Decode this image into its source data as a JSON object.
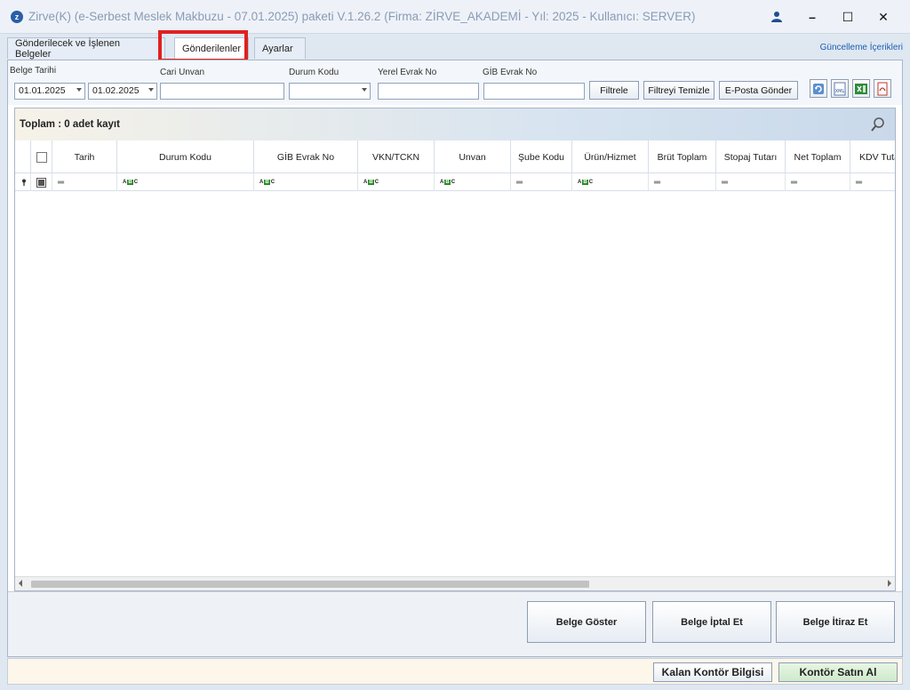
{
  "window": {
    "title": "Zirve(K)  (e-Serbest Meslek Makbuzu - 07.01.2025) paketi V.1.26.2 (Firma: ZİRVE_AKADEMİ - Yıl: 2025 - Kullanıcı: SERVER)",
    "minimize": "–",
    "maximize": "☐",
    "close": "✕"
  },
  "tabs": [
    {
      "label": "Gönderilecek ve İşlenen Belgeler"
    },
    {
      "label": "Gönderilenler"
    },
    {
      "label": "Ayarlar"
    }
  ],
  "update_link": "Güncelleme İçerikleri",
  "filters": {
    "belge_tarihi_label": "Belge Tarihi",
    "date_from": "01.01.2025",
    "date_to": "01.02.2025",
    "cari_unvan_label": "Cari Unvan",
    "cari_unvan_value": "",
    "durum_kodu_label": "Durum Kodu",
    "durum_kodu_value": "",
    "yerel_evrak_label": "Yerel Evrak No",
    "yerel_evrak_value": "",
    "gib_evrak_label": "GİB Evrak No",
    "gib_evrak_value": "",
    "filtrele": "Filtrele",
    "filtreyi_temizle": "Filtreyi Temizle",
    "eposta_gonder": "E-Posta Gönder",
    "xml_label": "XML"
  },
  "grid": {
    "total": "Toplam : 0 adet kayıt",
    "columns": [
      "Tarih",
      "Durum Kodu",
      "GİB Evrak No",
      "VKN/TCKN",
      "Unvan",
      "Şube Kodu",
      "Ürün/Hizmet",
      "Brüt Toplam",
      "Stopaj Tutarı",
      "Net Toplam",
      "KDV Tuta"
    ],
    "filter_row_types": [
      "eq",
      "abc",
      "abc",
      "abc",
      "abc",
      "eq",
      "abc",
      "eq",
      "eq",
      "eq",
      "eq"
    ],
    "abc_text": {
      "a": "A",
      "b": "B",
      "c": "C"
    }
  },
  "actions": {
    "belge_goster": "Belge Göster",
    "belge_iptal": "Belge İptal Et",
    "belge_itiraz": "Belge İtiraz Et"
  },
  "status": {
    "kalan_kontor": "Kalan Kontör Bilgisi",
    "kontor_satin_al": "Kontör Satın Al"
  },
  "colors": {
    "highlight": "#e02020",
    "link": "#1a5fb0",
    "buy_button": "#d9f0d6"
  }
}
